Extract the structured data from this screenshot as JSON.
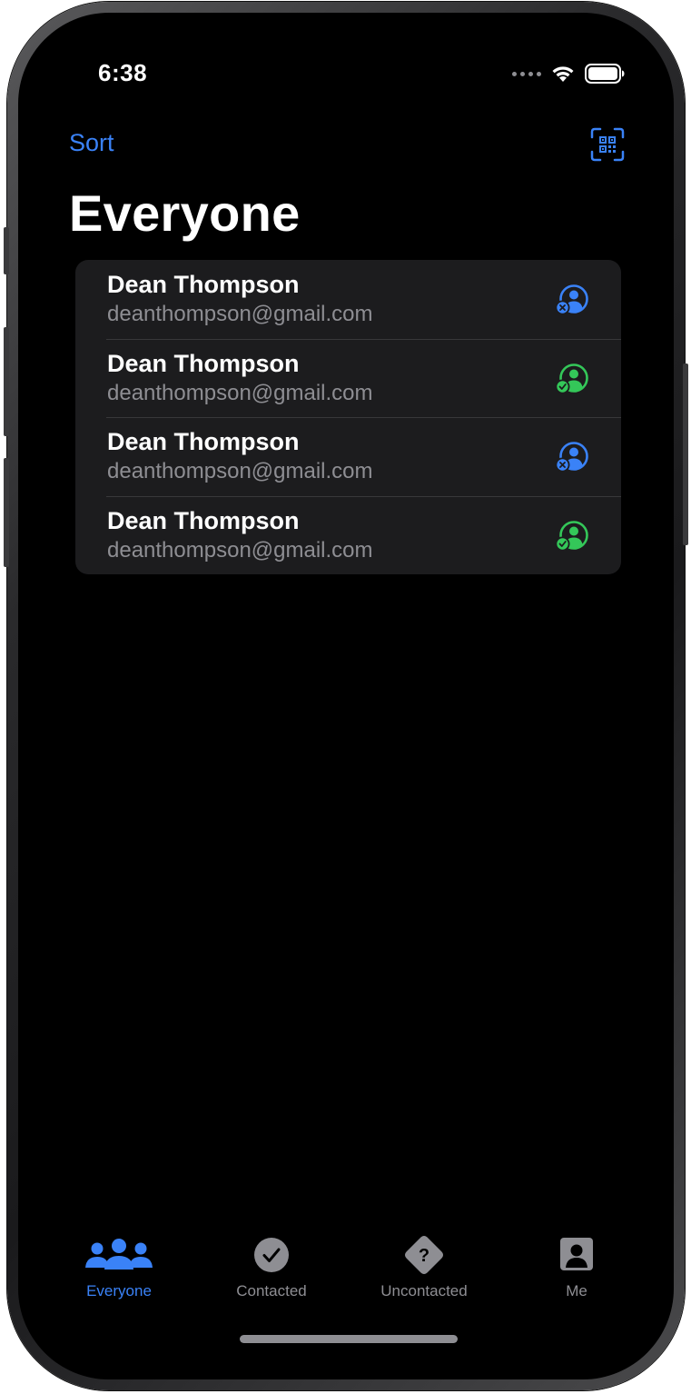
{
  "status_bar": {
    "time": "6:38"
  },
  "nav": {
    "sort_label": "Sort",
    "qr_icon": "qr-scan-icon"
  },
  "page": {
    "title": "Everyone"
  },
  "contacts": [
    {
      "name": "Dean Thompson",
      "email": "deanthompson@gmail.com",
      "status": "uncontacted",
      "icon": "person-x-icon"
    },
    {
      "name": "Dean Thompson",
      "email": "deanthompson@gmail.com",
      "status": "contacted",
      "icon": "person-check-icon"
    },
    {
      "name": "Dean Thompson",
      "email": "deanthompson@gmail.com",
      "status": "uncontacted",
      "icon": "person-x-icon"
    },
    {
      "name": "Dean Thompson",
      "email": "deanthompson@gmail.com",
      "status": "contacted",
      "icon": "person-check-icon"
    }
  ],
  "tabs": [
    {
      "label": "Everyone",
      "icon": "people-icon",
      "active": true
    },
    {
      "label": "Contacted",
      "icon": "checkmark-circle-icon",
      "active": false
    },
    {
      "label": "Uncontacted",
      "icon": "question-diamond-icon",
      "active": false
    },
    {
      "label": "Me",
      "icon": "person-square-icon",
      "active": false
    }
  ],
  "colors": {
    "accent": "#3a82f7",
    "contacted": "#34c759",
    "uncontacted": "#3a82f7",
    "background": "#000000",
    "list_background": "#1c1c1e",
    "secondary_text": "#8e8e93"
  }
}
